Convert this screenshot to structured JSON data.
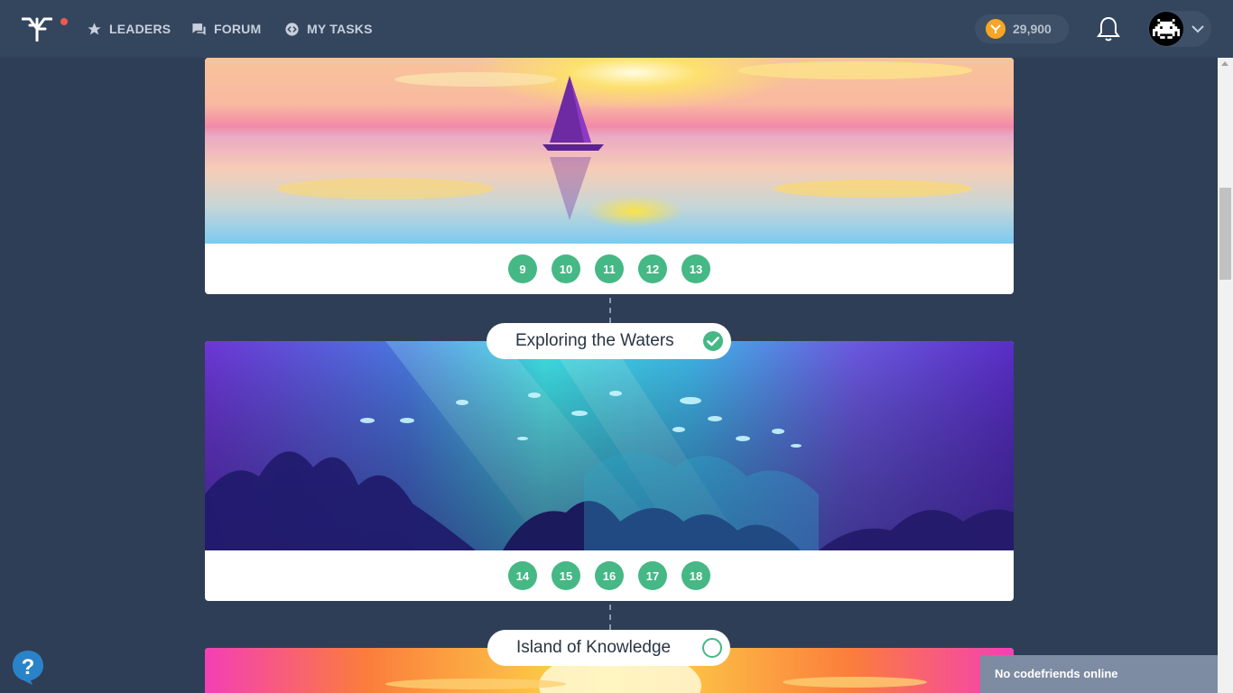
{
  "nav": {
    "leaders": "LEADERS",
    "forum": "FORUM",
    "my_tasks": "MY TASKS"
  },
  "coins": "29,900",
  "cards": [
    {
      "levels": [
        "9",
        "10",
        "11",
        "12",
        "13"
      ]
    },
    {
      "title": "Exploring the Waters",
      "status": "completed",
      "levels": [
        "14",
        "15",
        "16",
        "17",
        "18"
      ]
    },
    {
      "title": "Island of Knowledge",
      "status": "not-completed"
    }
  ],
  "online_status": "No codefriends online",
  "colors": {
    "background": "#2e3e56",
    "header": "#34465e",
    "level_badge": "#45b885",
    "check": "#45b885",
    "notification_dot": "#ef5a4a",
    "coin": "#f6a623"
  }
}
